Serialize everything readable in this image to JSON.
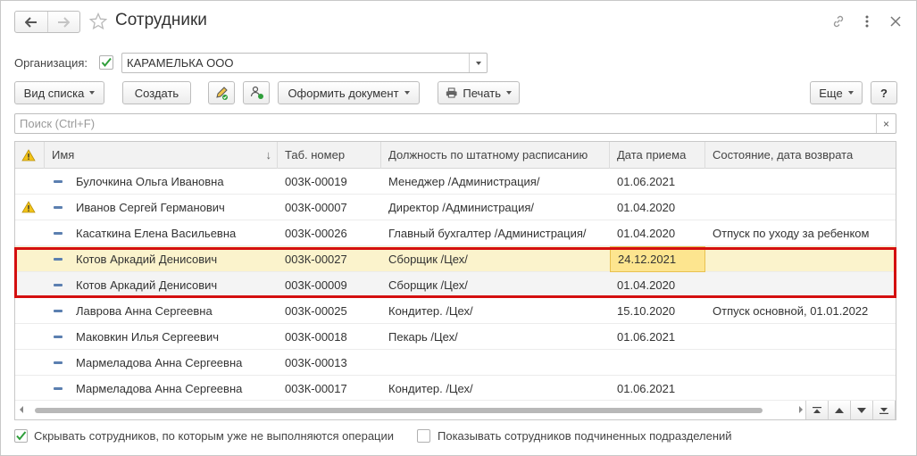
{
  "window": {
    "title": "Сотрудники"
  },
  "organization": {
    "label": "Организация:",
    "value": "КАРАМЕЛЬКА ООО",
    "checked": true
  },
  "toolbar": {
    "view_list": "Вид списка",
    "create": "Создать",
    "make_document": "Оформить документ",
    "print": "Печать",
    "more": "Еще",
    "help": "?"
  },
  "search": {
    "placeholder": "Поиск (Ctrl+F)",
    "clear": "×"
  },
  "table": {
    "columns": {
      "name": "Имя",
      "tab_number": "Таб. номер",
      "position": "Должность по штатному расписанию",
      "hire_date": "Дата приема",
      "state": "Состояние, дата возврата"
    },
    "sort_indicator": "↓",
    "rows": [
      {
        "name": "Булочкина Ольга Ивановна",
        "tab": "003К-00019",
        "position": "Менеджер /Администрация/",
        "hire": "01.06.2021",
        "state": ""
      },
      {
        "name": "Иванов Сергей Германович",
        "tab": "003К-00007",
        "position": "Директор /Администрация/",
        "hire": "01.04.2020",
        "state": "",
        "warning": true
      },
      {
        "name": "Касаткина Елена Васильевна",
        "tab": "003К-00026",
        "position": "Главный бухгалтер /Администрация/",
        "hire": "01.04.2020",
        "state": "Отпуск по уходу за ребенком"
      },
      {
        "name": "Котов Аркадий Денисович",
        "tab": "003К-00027",
        "position": "Сборщик /Цех/",
        "hire": "24.12.2021",
        "state": ""
      },
      {
        "name": "Котов Аркадий Денисович",
        "tab": "003К-00009",
        "position": "Сборщик /Цех/",
        "hire": "01.04.2020",
        "state": ""
      },
      {
        "name": "Лаврова Анна Сергеевна",
        "tab": "003К-00025",
        "position": "Кондитер. /Цех/",
        "hire": "15.10.2020",
        "state": "Отпуск основной, 01.01.2022"
      },
      {
        "name": "Маковкин Илья Сергеевич",
        "tab": "003К-00018",
        "position": "Пекарь /Цех/",
        "hire": "01.06.2021",
        "state": ""
      },
      {
        "name": "Мармеладова Анна Сергеевна",
        "tab": "003К-00013",
        "position": "",
        "hire": "",
        "state": ""
      },
      {
        "name": "Мармеладова Анна Сергеевна",
        "tab": "003К-00017",
        "position": "Кондитер. /Цех/",
        "hire": "01.06.2021",
        "state": ""
      }
    ]
  },
  "filters": {
    "hide_inactive": {
      "label": "Скрывать сотрудников, по которым уже не выполняются операции",
      "checked": true
    },
    "show_subordinate": {
      "label": "Показывать сотрудников подчиненных подразделений",
      "checked": false
    }
  },
  "colors": {
    "selected_row": "#fbf3cc",
    "focus_cell": "#fde58f",
    "highlight_border": "#d40f0f",
    "check_green": "#2e9e3a",
    "warning_yellow": "#f2c318"
  }
}
